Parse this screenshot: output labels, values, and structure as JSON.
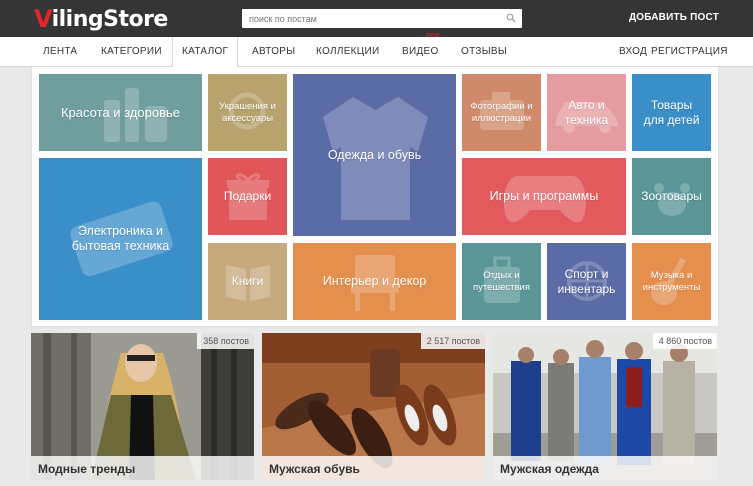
{
  "header": {
    "logo_accent": "V",
    "logo_rest": "ilingStore",
    "search_placeholder": "поиск по постам",
    "add_post_label": "ДОБАВИТЬ ПОСТ"
  },
  "nav": {
    "items": [
      {
        "label": "ЛЕНТА"
      },
      {
        "label": "КАТЕГОРИИ"
      },
      {
        "label": "КАТАЛОГ",
        "active": true
      },
      {
        "label": "АВТОРЫ"
      },
      {
        "label": "КОЛЛЕКЦИИ"
      },
      {
        "label": "ВИДЕО",
        "badge": "new"
      },
      {
        "label": "ОТЗЫВЫ"
      }
    ],
    "login_label": "ВХОД",
    "register_label": "РЕГИСТРАЦИЯ"
  },
  "catalog": {
    "tiles": [
      {
        "label": "Красота и здоровье",
        "color": "#6f9e9c"
      },
      {
        "label": "Украшения и аксессуары",
        "color": "#b8a36d"
      },
      {
        "label": "Одежда и обувь",
        "color": "#5b6ba5"
      },
      {
        "label": "Фотографии и иллюстрации",
        "color": "#d08a6b"
      },
      {
        "label": "Авто и техника",
        "color": "#e49ca0"
      },
      {
        "label": "Товары для детей",
        "color": "#3a8fc9"
      },
      {
        "label": "Электроника и бытовая техника",
        "color": "#3a8fc9"
      },
      {
        "label": "Подарки",
        "color": "#e05659"
      },
      {
        "label": "Игры и программы",
        "color": "#e35a5d"
      },
      {
        "label": "Зоотовары",
        "color": "#5a9697"
      },
      {
        "label": "Книги",
        "color": "#c7a97e"
      },
      {
        "label": "Интерьер и декор",
        "color": "#e58f4e"
      },
      {
        "label": "Отдых и путешествия",
        "color": "#5a9697"
      },
      {
        "label": "Спорт и инвентарь",
        "color": "#5b6ba5"
      },
      {
        "label": "Музыка и инструменты",
        "color": "#e58f4e"
      }
    ]
  },
  "collections": [
    {
      "title": "Модные тренды",
      "count": "358 постов"
    },
    {
      "title": "Мужская обувь",
      "count": "2 517 постов"
    },
    {
      "title": "Мужская одежда",
      "count": "4 860 постов"
    }
  ]
}
